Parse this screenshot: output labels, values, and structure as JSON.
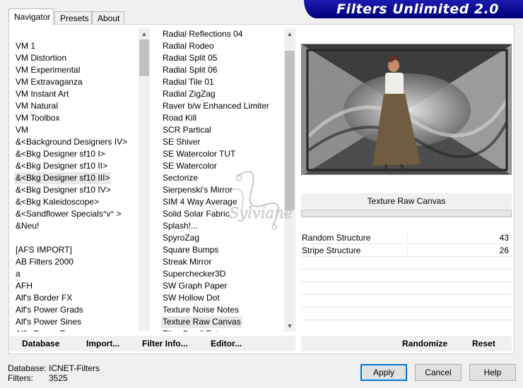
{
  "tabs": [
    {
      "label": "Navigator",
      "active": true
    },
    {
      "label": "Presets",
      "active": false
    },
    {
      "label": "About",
      "active": false
    }
  ],
  "banner": {
    "title": "Filters Unlimited 2.0",
    "color": "#00008b"
  },
  "categories": [
    "VM 1",
    "VM Distortion",
    "VM Experimental",
    "VM Extravaganza",
    "VM Instant Art",
    "VM Natural",
    "VM Toolbox",
    "VM",
    "&<Background Designers IV>",
    "&<Bkg Designer sf10 I>",
    "&<Bkg Designer sf10 II>",
    "&<Bkg Designer sf10 III>",
    "&<Bkg Designer sf10 IV>",
    "&<Bkg Kaleidoscope>",
    "&<Sandflower Specials°v° >",
    "&Neu!",
    "",
    "[AFS IMPORT]",
    "AB Filters 2000",
    "a",
    "AFH",
    "Alf's Border FX",
    "Alf's Power Grads",
    "Alf's Power Sines",
    "Alf's Power Toys"
  ],
  "categories_selected": "&<Bkg Designer sf10 III>",
  "filters": [
    "Radial Reflections 04",
    "Radial Rodeo",
    "Radial Split 05",
    "Radial Split 06",
    "Radial Tile 01",
    "Radial ZigZag",
    "Raver b/w Enhanced Limiter",
    "Road Kill",
    "SCR  Partical",
    "SE Shiver",
    "SE Watercolor TUT",
    "SE Watercolor",
    "Sectorize",
    "Sierpenski's Mirror",
    "SIM 4 Way Average",
    "Solid Solar Fabric",
    "Splash!...",
    "SpyroZag",
    "Square Bumps",
    "Streak Mirror",
    "Superchecker3D",
    "SW Graph Paper",
    "SW Hollow Dot",
    "Texture Noise Notes",
    "Texture Raw Canvas",
    "Tiles Small Ext..."
  ],
  "filters_selected": "Texture Raw Canvas",
  "current_filter": "Texture Raw Canvas",
  "params": [
    {
      "label": "Random Structure",
      "value": "43"
    },
    {
      "label": "Stripe Structure",
      "value": "26"
    }
  ],
  "bottom_bar": {
    "database": "Database",
    "import": "Import...",
    "filter_info": "Filter Info...",
    "editor": "Editor...",
    "randomize": "Randomize",
    "reset": "Reset"
  },
  "footer": {
    "database_label": "Database:",
    "database_value": "ICNET-Filters",
    "filters_label": "Filters:",
    "filters_value": "3525"
  },
  "buttons": {
    "apply": "Apply",
    "cancel": "Cancel",
    "help": "Help"
  },
  "watermark": "Sylviane",
  "icons": {
    "scroll_up": "chevron-up-icon",
    "scroll_down": "chevron-down-icon"
  }
}
